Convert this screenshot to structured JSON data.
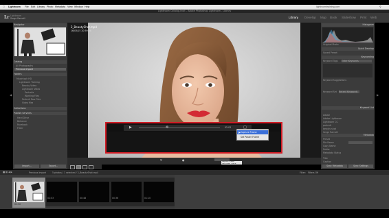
{
  "menubar": {
    "app": "Lightroom",
    "items": [
      "File",
      "Edit",
      "Library",
      "Photo",
      "Metadata",
      "View",
      "Window",
      "Help"
    ],
    "status": "lightroomtraining.com"
  },
  "window_title": "Lightroom Catalog.lrcat - Adobe Photoshop Lightroom - Library",
  "identity": {
    "logo": "Lr",
    "line1": "Lightroom",
    "line2": "Serge Ramelli"
  },
  "modules": [
    {
      "label": "Library",
      "active": true
    },
    {
      "label": "Develop",
      "active": false
    },
    {
      "label": "Map",
      "active": false
    },
    {
      "label": "Book",
      "active": false
    },
    {
      "label": "Slideshow",
      "active": false
    },
    {
      "label": "Print",
      "active": false
    },
    {
      "label": "Web",
      "active": false
    }
  ],
  "left_panel": {
    "navigator": "Navigator",
    "catalog": "Catalog",
    "catalog_items": [
      "All Photographs",
      "Previous Import"
    ],
    "folders": "Folders",
    "folder_items": [
      "Macintosh HD",
      "Lightroom Training",
      "Beauty Video",
      "Lightroom Video",
      "Portraits",
      "Working Files",
      "Portrait Raw Files",
      "Video files"
    ],
    "collections": "Collections",
    "publish": "Publish Services",
    "publish_items": [
      "Hard Drive",
      "Behance",
      "Facebook",
      "Flickr"
    ],
    "import_label": "Import...",
    "export_label": "Export..."
  },
  "image_overlay": {
    "filename": "2_BeautyShot.mp4",
    "meta": "16/03/15 20:59:36"
  },
  "video": {
    "time": "02:03",
    "context_menu": [
      "Capture Frame",
      "Set Poster Frame"
    ]
  },
  "toolbar": {
    "mini_menu": [
      "Capture Frame",
      "Set Poster Frame"
    ]
  },
  "right_panel": {
    "histogram": "Histogram",
    "histogram_label": "Original Photo",
    "quick_develop": "Quick Develop",
    "saved_preset": "Saved Preset",
    "custom": "Custom",
    "keywording": "Keywording",
    "keyword_tags": "Keyword Tags",
    "enter_keywords": "Enter Keywords",
    "keyword_suggestions": "Keyword Suggestions",
    "keyword_set": "Keyword Set",
    "recent_keywords": "Recent Keywords",
    "keyword_list": "Keyword List",
    "metadata": "Metadata",
    "comments": "Comments",
    "sync_label": "Sync Metadata",
    "sync_settings": "Sync Settings",
    "metadata_rows": [
      "Preset",
      "File Name",
      "Copy Name",
      "Folder",
      "Metadata Status",
      "Title",
      "Caption"
    ],
    "keyword_rows": [
      "Adobe",
      "Adobe Lightroom",
      "Lightroom CC",
      "portrait",
      "beauty shot",
      "Serge Ramelli",
      "video"
    ]
  },
  "filmstrip_bar": {
    "source": "Previous Import",
    "count": "5 photos / 1 selected / 2_BeautyShot.mp4",
    "filter": "Filter:",
    "filter_value": "Filters Off"
  },
  "filmstrip": {
    "durations": [
      "01:32",
      "02:03",
      "00:48",
      "00:36",
      "01:10"
    ]
  },
  "colors": {
    "highlight_red": "#d21c25",
    "lips": "#d32a34",
    "menu_highlight": "#3a6fd8",
    "panel": "#3b3b3b"
  }
}
